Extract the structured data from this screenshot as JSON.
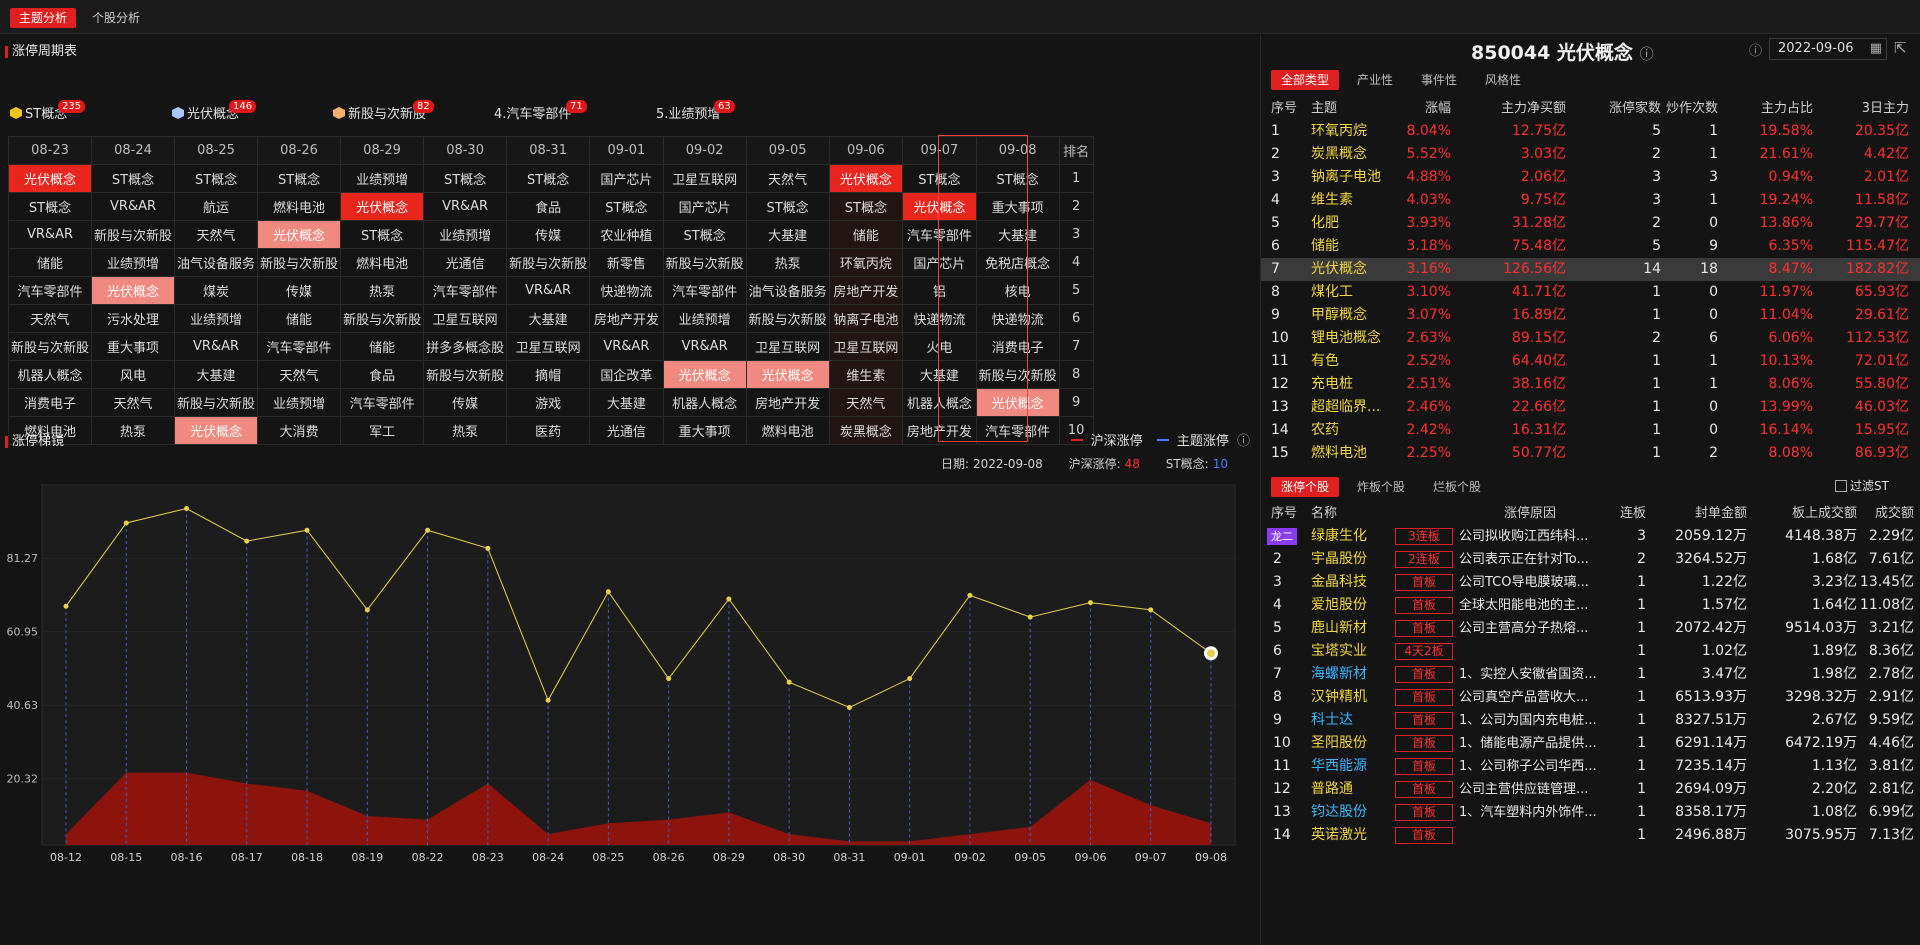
{
  "top_tabs": [
    "主题分析",
    "个股分析"
  ],
  "cycle": {
    "title": "涨停周期表",
    "tags": [
      {
        "num": "",
        "label": "ST概念",
        "badge": "235",
        "color": "#f5c518"
      },
      {
        "num": "",
        "label": "光伏概念",
        "badge": "146",
        "color": "#a8c8ff"
      },
      {
        "num": "",
        "label": "新股与次新股",
        "badge": "82",
        "color": "#f5b070"
      },
      {
        "num": "4.",
        "label": "汽车零部件",
        "badge": "71",
        "color": ""
      },
      {
        "num": "5.",
        "label": "业绩预增",
        "badge": "63",
        "color": ""
      }
    ],
    "dates": [
      "08-23",
      "08-24",
      "08-25",
      "08-26",
      "08-29",
      "08-30",
      "08-31",
      "09-01",
      "09-02",
      "09-05",
      "09-06",
      "09-07",
      "09-08"
    ],
    "rank_header": "排名",
    "left_edge": [
      "念",
      "R",
      "新股",
      "增",
      "念",
      "念",
      "",
      "",
      "业",
      "件"
    ],
    "rows": [
      [
        "光伏概念",
        "ST概念",
        "ST概念",
        "ST概念",
        "业绩预增",
        "ST概念",
        "ST概念",
        "国产芯片",
        "卫星互联网",
        "天然气",
        "光伏概念",
        "ST概念",
        "ST概念"
      ],
      [
        "ST概念",
        "VR&AR",
        "航运",
        "燃料电池",
        "光伏概念",
        "VR&AR",
        "食品",
        "ST概念",
        "国产芯片",
        "ST概念",
        "ST概念",
        "光伏概念",
        "重大事项"
      ],
      [
        "VR&AR",
        "新股与次新股",
        "天然气",
        "光伏概念",
        "ST概念",
        "业绩预增",
        "传媒",
        "农业种植",
        "ST概念",
        "大基建",
        "储能",
        "汽车零部件",
        "大基建"
      ],
      [
        "储能",
        "业绩预增",
        "油气设备服务",
        "新股与次新股",
        "燃料电池",
        "光通信",
        "新股与次新股",
        "新零售",
        "新股与次新股",
        "热泵",
        "环氧丙烷",
        "国产芯片",
        "免税店概念"
      ],
      [
        "汽车零部件",
        "光伏概念",
        "煤炭",
        "传媒",
        "热泵",
        "汽车零部件",
        "VR&AR",
        "快递物流",
        "汽车零部件",
        "油气设备服务",
        "房地产开发",
        "铝",
        "核电"
      ],
      [
        "天然气",
        "污水处理",
        "业绩预增",
        "储能",
        "新股与次新股",
        "卫星互联网",
        "大基建",
        "房地产开发",
        "业绩预增",
        "新股与次新股",
        "钠离子电池",
        "快递物流",
        "快递物流"
      ],
      [
        "新股与次新股",
        "重大事项",
        "VR&AR",
        "汽车零部件",
        "储能",
        "拼多多概念股",
        "卫星互联网",
        "VR&AR",
        "VR&AR",
        "卫星互联网",
        "卫星互联网",
        "火电",
        "消费电子"
      ],
      [
        "机器人概念",
        "风电",
        "大基建",
        "天然气",
        "食品",
        "新股与次新股",
        "摘帽",
        "国企改革",
        "光伏概念",
        "光伏概念",
        "维生素",
        "大基建",
        "新股与次新股"
      ],
      [
        "消费电子",
        "天然气",
        "新股与次新股",
        "业绩预增",
        "汽车零部件",
        "传媒",
        "游戏",
        "大基建",
        "机器人概念",
        "房地产开发",
        "天然气",
        "机器人概念",
        "光伏概念"
      ],
      [
        "燃料电池",
        "热泵",
        "光伏概念",
        "大消费",
        "军工",
        "热泵",
        "医药",
        "光通信",
        "重大事项",
        "燃料电池",
        "炭黑概念",
        "房地产开发",
        "汽车零部件"
      ]
    ],
    "highlight_hi": [
      [
        0,
        0
      ],
      [
        0,
        10
      ],
      [
        1,
        4
      ],
      [
        1,
        11
      ]
    ],
    "highlight_lo": [
      [
        2,
        3
      ],
      [
        4,
        1
      ],
      [
        7,
        8
      ],
      [
        7,
        9
      ],
      [
        8,
        12
      ],
      [
        9,
        2
      ]
    ],
    "edge_lo_rows": [
      4
    ]
  },
  "chart": {
    "title": "涨停梯镜",
    "legend": [
      "沪深涨停",
      "主题涨停"
    ],
    "info": {
      "date_label": "日期:",
      "date": "2022-09-08",
      "hs_label": "沪深涨停:",
      "hs_val": "48",
      "st_label": "ST概念:",
      "st_val": "10"
    }
  },
  "chart_data": {
    "type": "line",
    "x": [
      "08-12",
      "08-15",
      "08-16",
      "08-17",
      "08-18",
      "08-19",
      "08-22",
      "08-23",
      "08-24",
      "08-25",
      "08-26",
      "08-29",
      "08-30",
      "08-31",
      "09-01",
      "09-02",
      "09-05",
      "09-06",
      "09-07",
      "09-08"
    ],
    "yticks": [
      20.32,
      40.63,
      60.95,
      81.27
    ],
    "ylim": [
      2,
      101.5
    ],
    "series": [
      {
        "name": "主题涨停",
        "color": "#e8d048",
        "values": [
          68,
          91,
          95,
          86,
          89,
          67,
          89,
          84,
          42,
          72,
          48,
          70,
          47,
          40,
          48,
          71,
          65,
          69,
          67,
          55
        ]
      },
      {
        "name": "沪深涨停",
        "color": "#8c140c",
        "values": [
          5,
          22,
          22,
          19,
          17,
          10,
          9,
          19,
          5,
          8,
          9,
          11,
          5,
          3,
          3,
          5,
          7,
          20,
          13,
          8
        ]
      }
    ]
  },
  "concept": {
    "title": "850044 光伏概念",
    "date": "2022-09-06",
    "tabs": [
      "全部类型",
      "产业性",
      "事件性",
      "风格性"
    ],
    "headers": [
      "序号",
      "主题",
      "涨幅",
      "主力净买额",
      "涨停家数",
      "炒作次数",
      "主力占比",
      "3日主力"
    ],
    "rows": [
      [
        "1",
        "环氧丙烷",
        "8.04%",
        "12.75亿",
        "5",
        "1",
        "19.58%",
        "20.35亿"
      ],
      [
        "2",
        "炭黑概念",
        "5.52%",
        "3.03亿",
        "2",
        "1",
        "21.61%",
        "4.42亿"
      ],
      [
        "3",
        "钠离子电池",
        "4.88%",
        "2.06亿",
        "3",
        "3",
        "0.94%",
        "2.01亿"
      ],
      [
        "4",
        "维生素",
        "4.03%",
        "9.75亿",
        "3",
        "1",
        "19.24%",
        "11.58亿"
      ],
      [
        "5",
        "化肥",
        "3.93%",
        "31.28亿",
        "2",
        "0",
        "13.86%",
        "29.77亿"
      ],
      [
        "6",
        "储能",
        "3.18%",
        "75.48亿",
        "5",
        "9",
        "6.35%",
        "115.47亿"
      ],
      [
        "7",
        "光伏概念",
        "3.16%",
        "126.56亿",
        "14",
        "18",
        "8.47%",
        "182.82亿"
      ],
      [
        "8",
        "煤化工",
        "3.10%",
        "41.71亿",
        "1",
        "0",
        "11.97%",
        "65.93亿"
      ],
      [
        "9",
        "甲醇概念",
        "3.07%",
        "16.89亿",
        "1",
        "0",
        "11.04%",
        "29.61亿"
      ],
      [
        "10",
        "锂电池概念",
        "2.63%",
        "89.15亿",
        "2",
        "6",
        "6.06%",
        "112.53亿"
      ],
      [
        "11",
        "有色",
        "2.52%",
        "64.40亿",
        "1",
        "1",
        "10.13%",
        "72.01亿"
      ],
      [
        "12",
        "充电桩",
        "2.51%",
        "38.16亿",
        "1",
        "1",
        "8.06%",
        "55.80亿"
      ],
      [
        "13",
        "超超临界...",
        "2.46%",
        "22.66亿",
        "1",
        "0",
        "13.99%",
        "46.03亿"
      ],
      [
        "14",
        "农药",
        "2.42%",
        "16.31亿",
        "1",
        "0",
        "16.14%",
        "15.95亿"
      ],
      [
        "15",
        "燃料电池",
        "2.25%",
        "50.77亿",
        "1",
        "2",
        "8.08%",
        "86.93亿"
      ]
    ]
  },
  "stocks": {
    "tabs": [
      "涨停个股",
      "炸板个股",
      "烂板个股"
    ],
    "filter": "过滤ST",
    "headers": [
      "序号",
      "名称",
      "涨停原因",
      "连板",
      "封单金额",
      "板上成交额",
      "成交额"
    ],
    "rows": [
      [
        "龙二",
        "绿康生化",
        "3连板",
        "公司拟收购江西纬科...",
        "3",
        "2059.12万",
        "4148.38万",
        "2.29亿",
        "yel"
      ],
      [
        "2",
        "宇晶股份",
        "2连板",
        "公司表示正在针对To...",
        "2",
        "3264.52万",
        "1.68亿",
        "7.61亿",
        "yel"
      ],
      [
        "3",
        "金晶科技",
        "首板",
        "公司TCO导电膜玻璃...",
        "1",
        "1.22亿",
        "3.23亿",
        "13.45亿",
        "yel"
      ],
      [
        "4",
        "爱旭股份",
        "首板",
        "全球太阳能电池的主...",
        "1",
        "1.57亿",
        "1.64亿",
        "11.08亿",
        "yel"
      ],
      [
        "5",
        "鹿山新材",
        "首板",
        "公司主营高分子热熔...",
        "1",
        "2072.42万",
        "9514.03万",
        "3.21亿",
        "yel"
      ],
      [
        "6",
        "宝塔实业",
        "4天2板",
        "",
        "1",
        "1.02亿",
        "1.89亿",
        "8.36亿",
        "yel"
      ],
      [
        "7",
        "海螺新材",
        "首板",
        "1、实控人安徽省国资...",
        "1",
        "3.47亿",
        "1.98亿",
        "2.78亿",
        "cyan"
      ],
      [
        "8",
        "汉钟精机",
        "首板",
        "公司真空产品营收大...",
        "1",
        "6513.93万",
        "3298.32万",
        "2.91亿",
        "yel"
      ],
      [
        "9",
        "科士达",
        "首板",
        "1、公司为国内充电桩...",
        "1",
        "8327.51万",
        "2.67亿",
        "9.59亿",
        "cyan"
      ],
      [
        "10",
        "圣阳股份",
        "首板",
        "1、储能电源产品提供...",
        "1",
        "6291.14万",
        "6472.19万",
        "4.46亿",
        "yel"
      ],
      [
        "11",
        "华西能源",
        "首板",
        "1、公司称子公司华西...",
        "1",
        "7235.14万",
        "1.13亿",
        "3.81亿",
        "cyan"
      ],
      [
        "12",
        "普路通",
        "首板",
        "公司主营供应链管理...",
        "1",
        "2694.09万",
        "2.20亿",
        "2.81亿",
        "yel"
      ],
      [
        "13",
        "钧达股份",
        "首板",
        "1、汽车塑料内外饰件...",
        "1",
        "8358.17万",
        "1.08亿",
        "6.99亿",
        "cyan"
      ],
      [
        "14",
        "英诺激光",
        "首板",
        "",
        "1",
        "2496.88万",
        "3075.95万",
        "7.13亿",
        "yel"
      ]
    ]
  }
}
